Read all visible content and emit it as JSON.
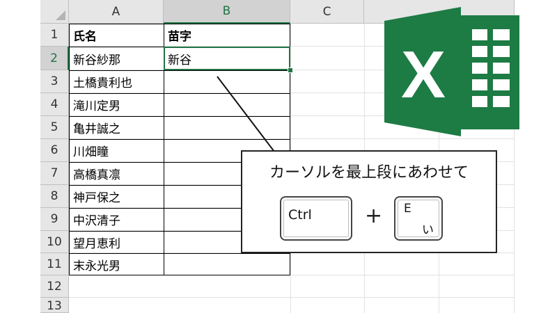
{
  "spreadsheet": {
    "column_headers": [
      "A",
      "B",
      "C"
    ],
    "selected_column": "B",
    "row_numbers": [
      "1",
      "2",
      "3",
      "4",
      "5",
      "6",
      "7",
      "8",
      "9",
      "10",
      "11",
      "12",
      "13"
    ],
    "selected_row": "2",
    "header_row": {
      "col_a": "氏名",
      "col_b": "苗字"
    },
    "rows": [
      {
        "col_a": "新谷紗那",
        "col_b": "新谷"
      },
      {
        "col_a": "土橋貴利也",
        "col_b": ""
      },
      {
        "col_a": "滝川定男",
        "col_b": ""
      },
      {
        "col_a": "亀井誠之",
        "col_b": ""
      },
      {
        "col_a": "川畑瞳",
        "col_b": ""
      },
      {
        "col_a": "高橋真凛",
        "col_b": ""
      },
      {
        "col_a": "神戸保之",
        "col_b": ""
      },
      {
        "col_a": "中沢清子",
        "col_b": ""
      },
      {
        "col_a": "望月恵利",
        "col_b": ""
      },
      {
        "col_a": "末永光男",
        "col_b": ""
      }
    ],
    "active_cell": "B2"
  },
  "callout": {
    "text": "カーソルを最上段にあわせて",
    "key1_label": "Ctrl",
    "plus": "+",
    "key2_label_top": "E",
    "key2_label_bottom": "い"
  },
  "logo": {
    "letter": "X",
    "icon": "excel-logo-icon"
  },
  "colors": {
    "excel_green": "#217346",
    "logo_green": "#1d7b44"
  }
}
